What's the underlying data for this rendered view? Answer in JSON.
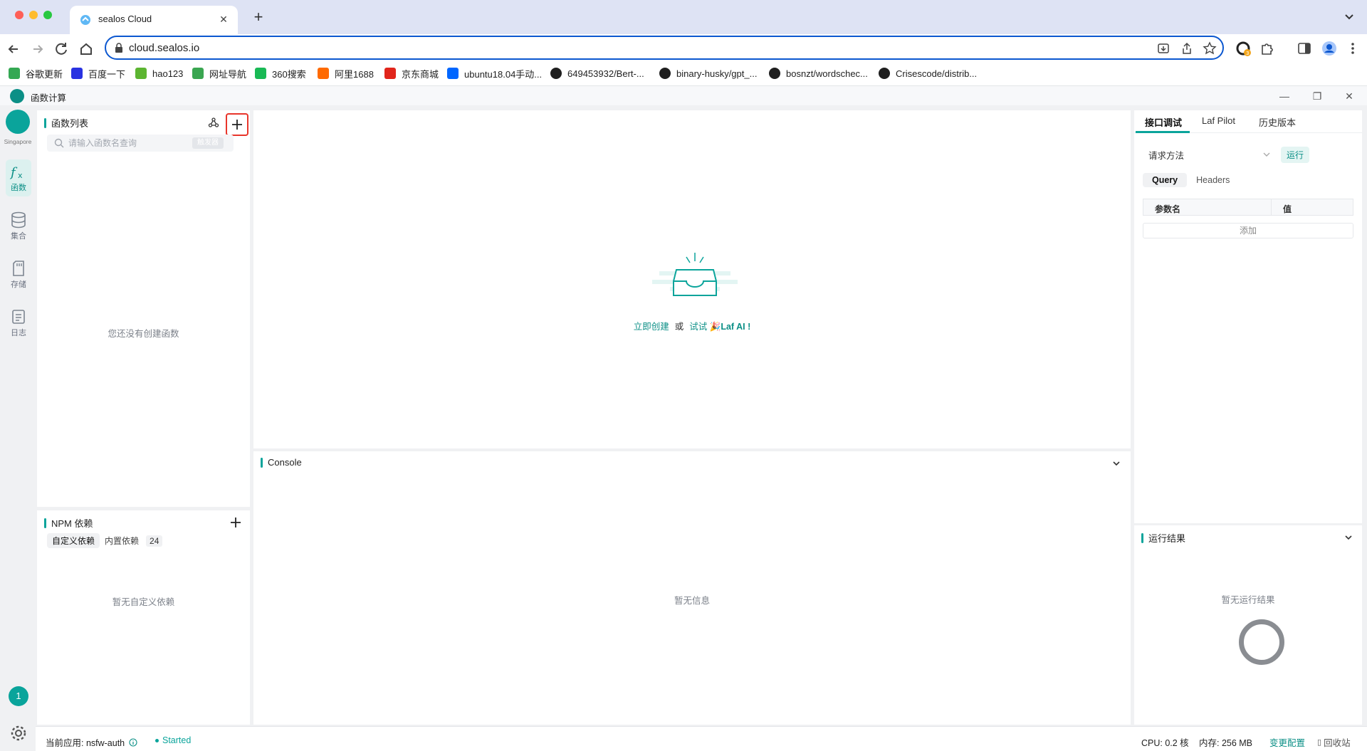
{
  "browser": {
    "tab_title": "sealos Cloud",
    "url": "cloud.sealos.io",
    "extension_badge": "3",
    "bookmarks": [
      {
        "label": "谷歌更新",
        "color": "#34a853"
      },
      {
        "label": "百度一下",
        "color": "#2932e1"
      },
      {
        "label": "hao123",
        "color": "#5cb531"
      },
      {
        "label": "网址导航",
        "color": "#3aa651"
      },
      {
        "label": "360搜索",
        "color": "#19b955"
      },
      {
        "label": "阿里1688",
        "color": "#ff6a00"
      },
      {
        "label": "京东商城",
        "color": "#e1251b"
      },
      {
        "label": "ubuntu18.04手动...",
        "color": "#0066ff"
      },
      {
        "label": "649453932/Bert-...",
        "color": "#1f1f1f"
      },
      {
        "label": "binary-husky/gpt_...",
        "color": "#1f1f1f"
      },
      {
        "label": "bosnzt/wordschec...",
        "color": "#1f1f1f"
      },
      {
        "label": "Crisescode/distrib...",
        "color": "#1f1f1f"
      }
    ]
  },
  "app": {
    "title": "函数计算",
    "region": "Singapore",
    "nav": [
      {
        "label": "函数",
        "icon": "function-icon",
        "active": true
      },
      {
        "label": "集合",
        "icon": "database-icon",
        "active": false
      },
      {
        "label": "存储",
        "icon": "storage-icon",
        "active": false
      },
      {
        "label": "日志",
        "icon": "log-icon",
        "active": false
      }
    ],
    "badge": "1"
  },
  "functions_panel": {
    "title": "函数列表",
    "search_placeholder": "请输入函数名查询",
    "trigger_label": "触发器",
    "empty": "您还没有创建函数"
  },
  "npm_panel": {
    "title": "NPM 依赖",
    "tab_custom": "自定义依赖",
    "tab_builtin": "内置依赖",
    "builtin_count": "24",
    "empty": "暂无自定义依赖"
  },
  "editor": {
    "create_link": "立即创建",
    "or": "或",
    "try_link": "试试",
    "ai_label": "Laf AI !"
  },
  "console": {
    "title": "Console",
    "empty": "暂无信息"
  },
  "debug_panel": {
    "tabs": [
      "接口调试",
      "Laf Pilot",
      "历史版本"
    ],
    "method_label": "请求方法",
    "run_label": "运行",
    "query_tab": "Query",
    "headers_tab": "Headers",
    "col_name": "参数名",
    "col_value": "值",
    "add_label": "添加"
  },
  "result_panel": {
    "title": "运行结果",
    "empty": "暂无运行结果"
  },
  "statusbar": {
    "current_app": "当前应用: nsfw-auth",
    "status": "Started",
    "cpu": "CPU: 0.2 核",
    "memory": "内存: 256 MB",
    "change_config": "变更配置",
    "recycle": "回收站"
  },
  "colors": {
    "accent": "#0aa49b",
    "highlight": "#e8352b"
  }
}
